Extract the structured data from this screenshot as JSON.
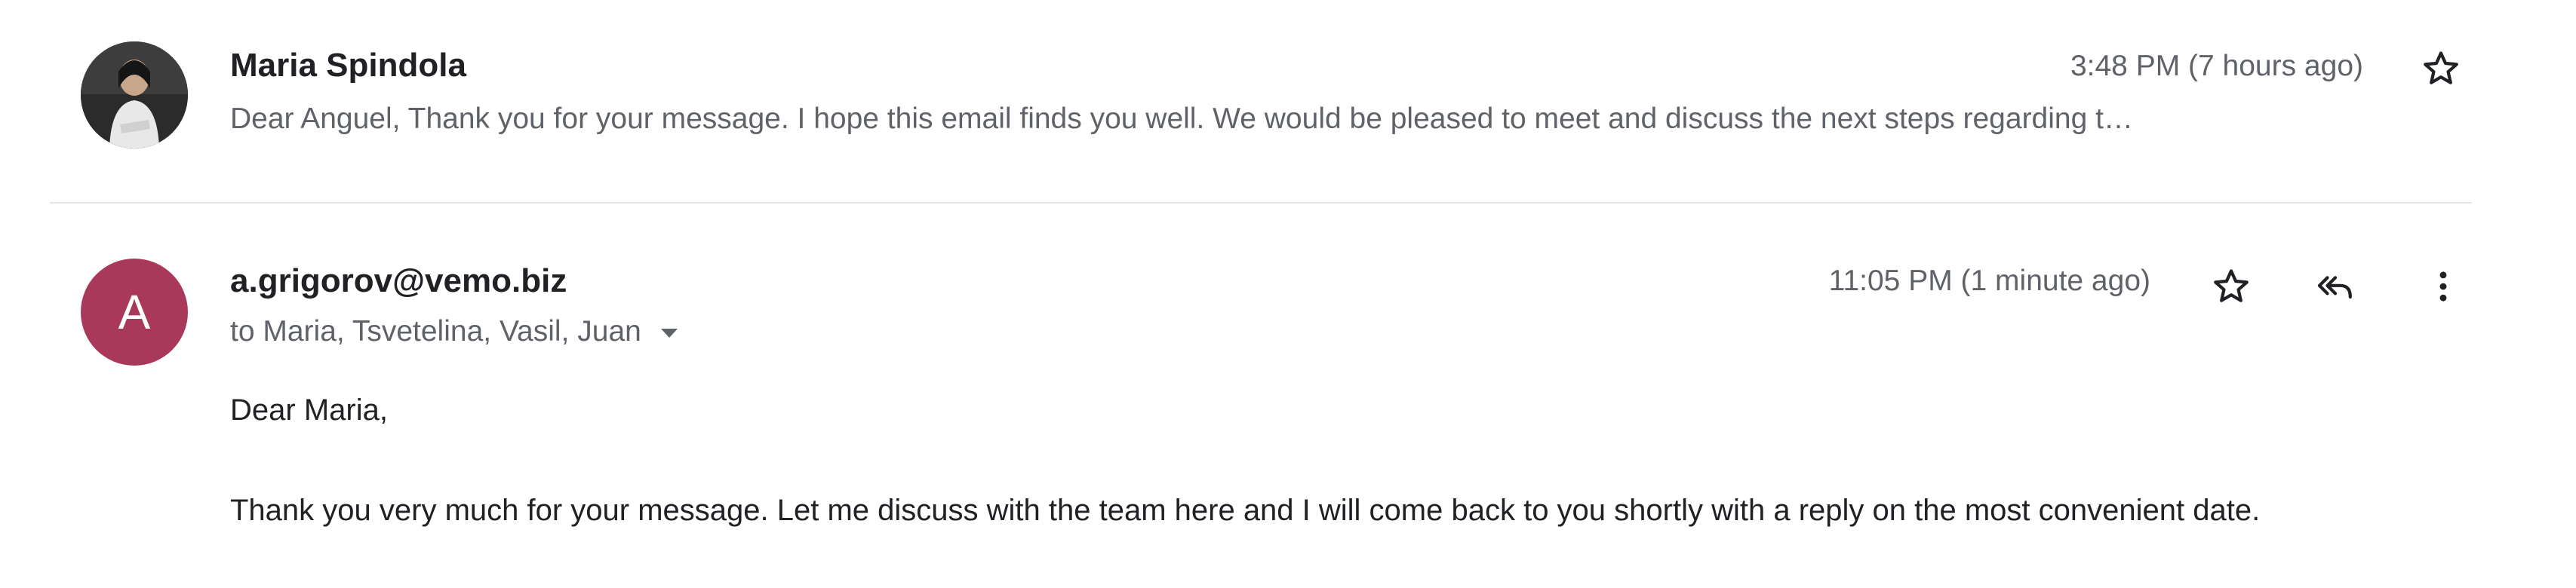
{
  "thread": {
    "messages": [
      {
        "sender": "Maria Spindola",
        "timestamp": "3:48 PM (7 hours ago)",
        "snippet": "Dear Anguel, Thank you for your message. I hope this email finds you well. We would be pleased to meet and discuss the next steps regarding t…",
        "avatar": "profile-photo"
      },
      {
        "sender": "a.grigorov@vemo.biz",
        "avatar_letter": "A",
        "avatar_color": "#a8395b",
        "timestamp": "11:05 PM (1 minute ago)",
        "recipients": "to Maria, Tsvetelina, Vasil, Juan",
        "greeting": "Dear Maria,",
        "body": "Thank you very much for your message. Let me discuss with the team here and I will come back to you shortly with a reply on the most convenient date."
      }
    ]
  },
  "icons": {
    "star": "star-outline-icon",
    "reply_all": "reply-all-icon",
    "more": "more-vertical-icon",
    "dropdown": "chevron-down-icon"
  }
}
